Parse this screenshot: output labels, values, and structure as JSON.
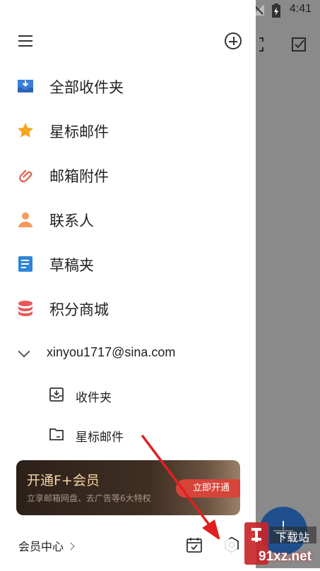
{
  "status_bar": {
    "time": "4:41"
  },
  "drawer": {
    "nav_items": [
      {
        "label": "全部收件夹",
        "icon": "inbox-tray-icon",
        "color": "#3d7fd6"
      },
      {
        "label": "星标邮件",
        "icon": "star-icon",
        "color": "#f5a623"
      },
      {
        "label": "邮箱附件",
        "icon": "paperclip-icon",
        "color": "#e06a5a"
      },
      {
        "label": "联系人",
        "icon": "person-icon",
        "color": "#f19a5a"
      },
      {
        "label": "草稿夹",
        "icon": "draft-doc-icon",
        "color": "#2f86d9"
      },
      {
        "label": "积分商城",
        "icon": "coins-stack-icon",
        "color": "#e8585a"
      }
    ],
    "account": {
      "email": "xinyou1717@sina.com"
    },
    "folders": [
      {
        "label": "收件夹",
        "icon": "inbox-icon"
      },
      {
        "label": "星标邮件",
        "icon": "folder-icon"
      }
    ],
    "vip_card": {
      "title": "开通F+会员",
      "subtitle": "立享邮箱网盘、去广告等6大特权",
      "button": "立即开通"
    },
    "footer": {
      "vip_center": "会员中心"
    }
  },
  "watermark": {
    "text": "91xz.net",
    "brand": "下载站"
  },
  "colors": {
    "fab": "#1f4f8c",
    "vip_button": "#d6443a",
    "annotation_arrow": "#e02020"
  }
}
